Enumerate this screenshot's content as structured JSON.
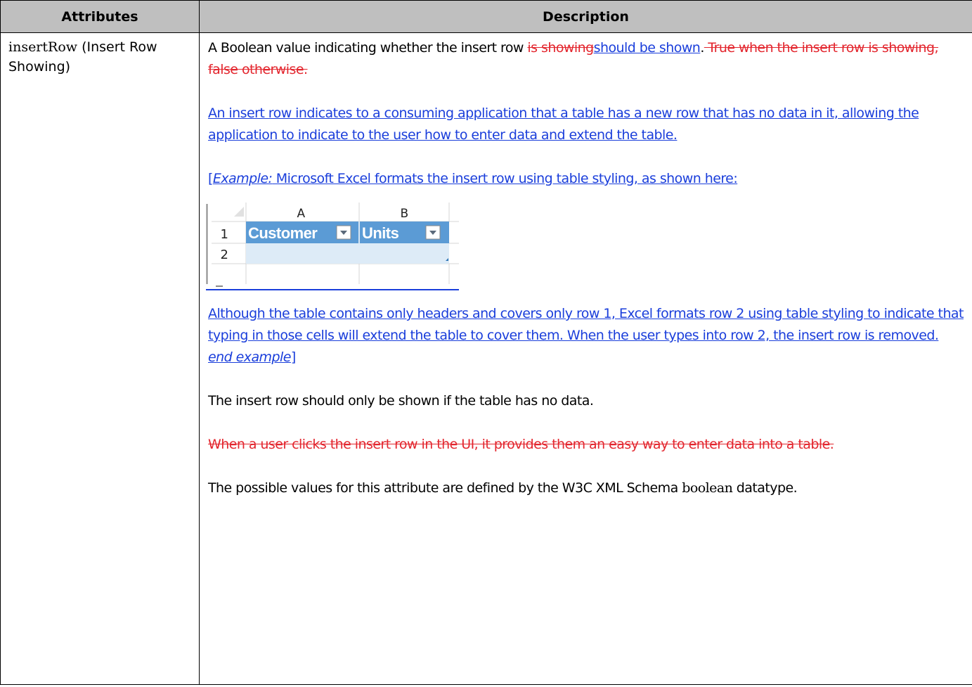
{
  "table": {
    "headers": [
      "Attributes",
      "Description"
    ],
    "attribute": {
      "name": "insertRow",
      "label": "(Insert Row Showing)"
    },
    "description": {
      "p1_a": "A Boolean value indicating whether the insert row ",
      "p1_del1": "is showing",
      "p1_ins1": "should be shown",
      "p1_b": ".",
      "p1_del2": " True when the insert row is showing, false otherwise.",
      "p2_ins": "An insert row indicates to a consuming application that a table has a new row that has no data in it, allowing the application to indicate to the user how to enter data and extend the table.",
      "p3_bracket": "[",
      "p3_em": "Example:",
      "p3_rest": " Microsoft Excel formats the insert row using table styling, as shown here:",
      "figure": {
        "col_a": "A",
        "col_b": "B",
        "row1": "1",
        "row2": "2",
        "header1": "Customer",
        "header2": "Units",
        "colors": {
          "header_fill": "#5b9bd5",
          "insert_fill": "#ddebf7"
        }
      },
      "p4_ins": "Although the table contains only headers and covers only row 1, Excel formats row 2 using table styling to indicate that typing in those cells will extend the table to cover them. When the user types into row 2, the insert row is removed. ",
      "p4_em": "end example",
      "p4_end": "]",
      "p5": "The insert row should only be shown if the table has no data.",
      "p6_del": " When a user clicks the insert row in the UI, it provides them an easy way to enter data into a table.",
      "p7_a": "The possible values for this attribute are defined by the W3C XML Schema ",
      "p7_serif": "boolean",
      "p7_b": " datatype."
    }
  }
}
